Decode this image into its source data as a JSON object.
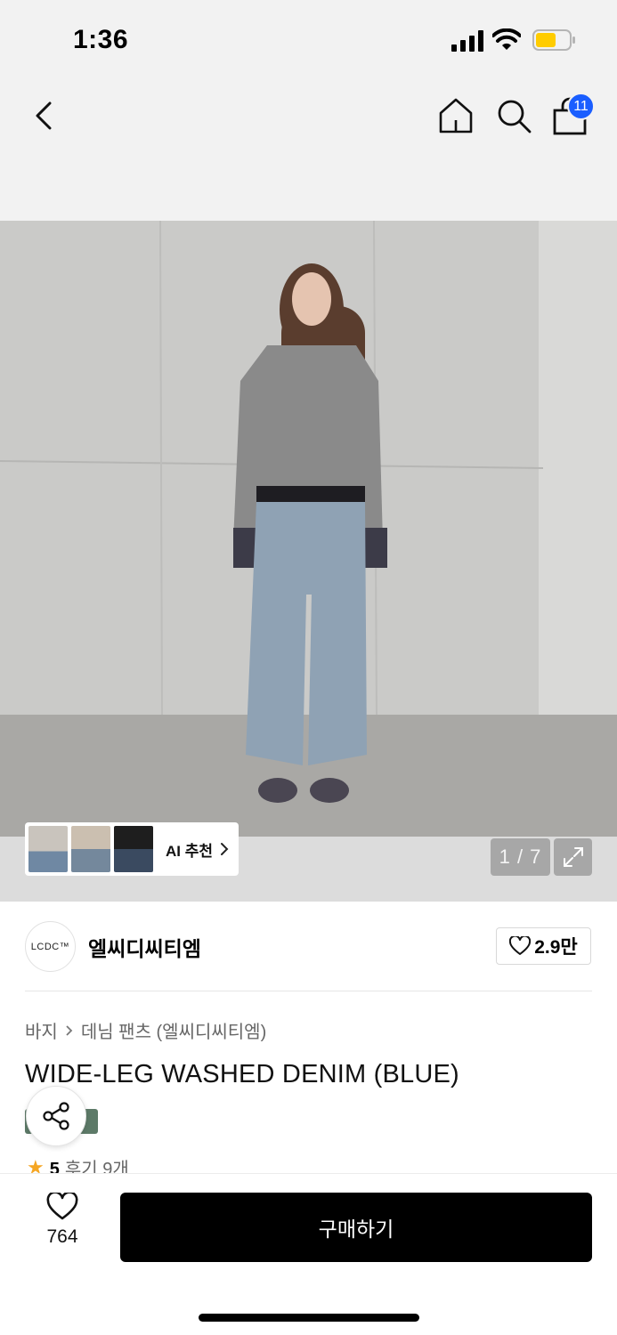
{
  "status_bar": {
    "time": "1:36",
    "battery_color": "#ffcc00",
    "icons": [
      "cellular-signal-icon",
      "wifi-icon",
      "battery-icon"
    ]
  },
  "nav": {
    "icons": [
      "chevron-left-icon",
      "home-icon",
      "search-icon",
      "shopping-bag-icon"
    ],
    "cart_count": "11",
    "badge_color": "#1a5eff"
  },
  "gallery": {
    "ai_label": "AI 추천",
    "counter": "1 / 7",
    "thumbnails": 3
  },
  "brand": {
    "logo_text": "LCDC™",
    "name": "엘씨디씨티엠",
    "likes": "2.9만"
  },
  "breadcrumb": {
    "category": "바지",
    "subcategory": "데님 팬츠 (엘씨디씨티엠)"
  },
  "product": {
    "title": "WIDE-LEG WASHED DENIM (BLUE)",
    "rating": "5",
    "reviews": "후기 9개"
  },
  "bottom": {
    "wish_count": "764",
    "buy_label": "구매하기"
  }
}
